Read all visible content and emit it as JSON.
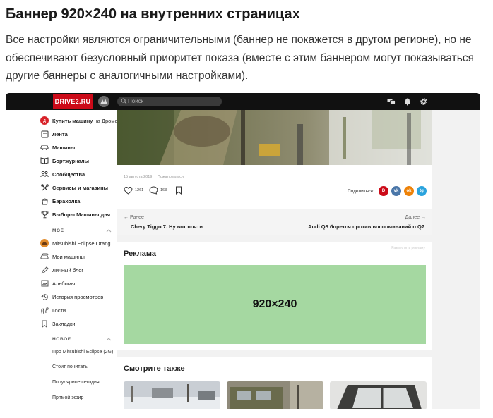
{
  "doc": {
    "title": "Баннер 920×240 на внутренних страницах",
    "paragraph": "Все настройки являются ограничительными (баннер не покажется в другом регионе), но не обеспечивают безусловный приоритет показа (вместе с этим баннером могут показываться другие баннеры с аналогичными настройками)."
  },
  "topbar": {
    "logo": "DRIVE2.RU",
    "search_placeholder": "Поиск",
    "icons": [
      "messages-icon",
      "bell-icon",
      "gear-icon"
    ]
  },
  "sidebar": {
    "items": [
      {
        "label": "Купить машину",
        "tail": " на Дроме",
        "icon": "drom-icon"
      },
      {
        "label": "Лента",
        "icon": "feed-icon"
      },
      {
        "label": "Машины",
        "icon": "car-icon"
      },
      {
        "label": "Бортжурналы",
        "icon": "journal-icon"
      },
      {
        "label": "Сообщества",
        "icon": "communities-icon"
      },
      {
        "label": "Сервисы и магазины",
        "icon": "services-icon"
      },
      {
        "label": "Барахолка",
        "icon": "market-icon"
      },
      {
        "label": "Выборы Машины дня",
        "icon": "trophy-icon"
      }
    ],
    "my_header": "МОЁ",
    "my_items": [
      {
        "label": "Mitsubishi Eclipse Orang...",
        "icon": "car-avatar-icon"
      },
      {
        "label": "Мои машины",
        "icon": "my-cars-icon"
      },
      {
        "label": "Личный блог",
        "icon": "blog-icon"
      },
      {
        "label": "Альбомы",
        "icon": "albums-icon"
      },
      {
        "label": "История просмотров",
        "icon": "history-icon"
      },
      {
        "label": "Гости",
        "icon": "guests-icon"
      },
      {
        "label": "Закладки",
        "icon": "bookmark-icon"
      }
    ],
    "new_header": "НОВОЕ",
    "new_items": [
      "Про Mitsubishi Eclipse (2G)",
      "Стоит почитать",
      "Популярное сегодня",
      "Прямой эфир"
    ]
  },
  "post": {
    "date": "15 августа 2019",
    "complain": "Пожаловаться",
    "likes": "1261",
    "comments": "163",
    "share_label": "Поделиться:",
    "share": [
      {
        "label": "D",
        "color": "#cc0a18",
        "icon": "drive2-share-icon"
      },
      {
        "label": "vk",
        "color": "#4a76a8",
        "icon": "vk-share-icon"
      },
      {
        "label": "ok",
        "color": "#ee8208",
        "icon": "ok-share-icon"
      },
      {
        "label": "tg",
        "color": "#2aa3dd",
        "icon": "telegram-share-icon"
      }
    ]
  },
  "nav": {
    "prev_label": "← Ранее",
    "prev_title": "Chery Tiggo 7. Ну вот почти",
    "next_label": "Далее →",
    "next_title": "Audi Q8 борется против воспоминаний о Q7"
  },
  "ad": {
    "title": "Реклама",
    "place_link": "Разместить рекламу",
    "banner_size": "920×240",
    "banner_color": "#a5d8a1"
  },
  "related": {
    "title": "Смотрите также"
  },
  "colors": {
    "brand": "#cc0a18",
    "topbar": "#111111"
  }
}
